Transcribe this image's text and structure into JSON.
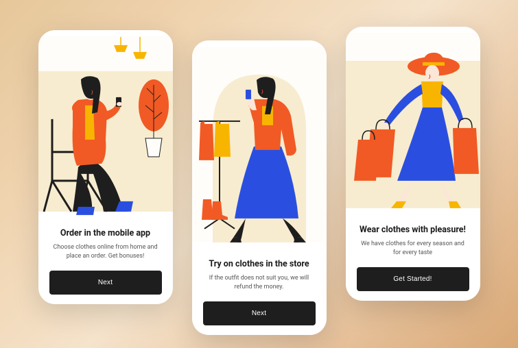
{
  "screens": [
    {
      "title": "Order in the mobile app",
      "desc": "Choose clothes online from home and place an order. Get bonuses!",
      "cta": "Next"
    },
    {
      "title": "Try on clothes in the store",
      "desc": "If the outfit does not suit you, we will refund the money.",
      "cta": "Next"
    },
    {
      "title": "Wear clothes with pleasure!",
      "desc": "We have clothes for every season and for every taste",
      "cta": "Get Started!"
    }
  ],
  "colors": {
    "accent_orange": "#f15a24",
    "accent_blue": "#1f3fd4",
    "accent_yellow": "#f8b500",
    "cream": "#f7eccf",
    "dark": "#1e1e1e"
  }
}
